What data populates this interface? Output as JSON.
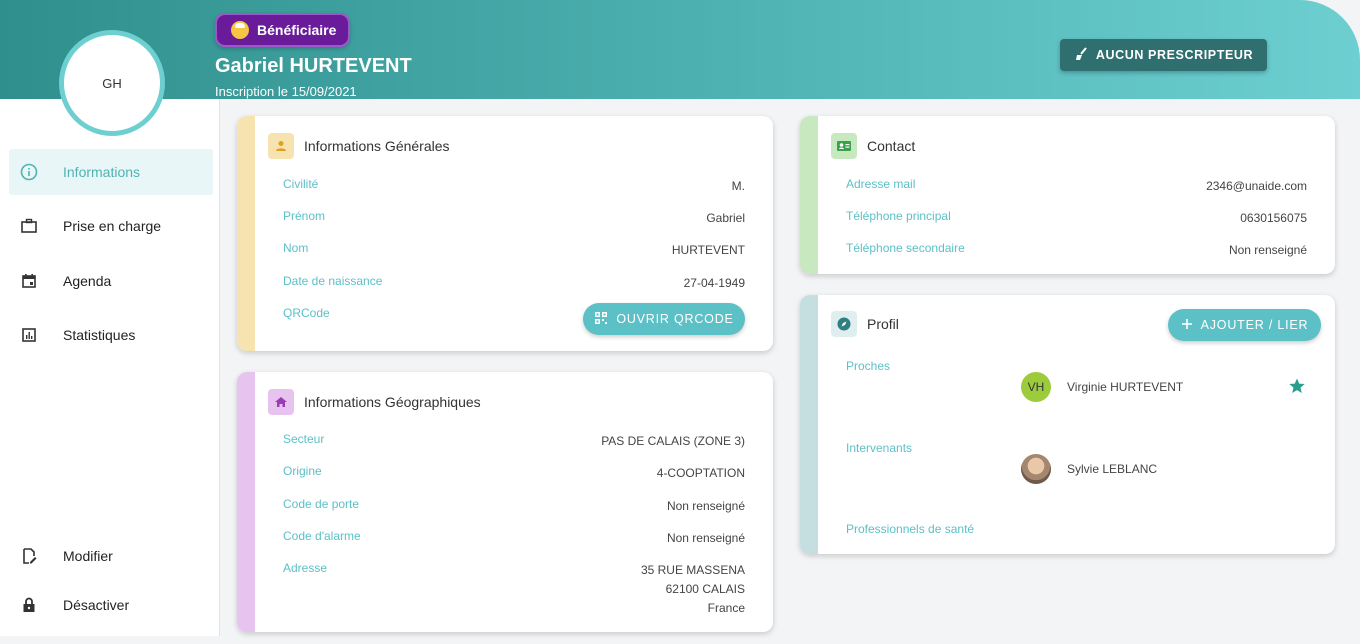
{
  "header": {
    "role_badge": "Bénéficiaire",
    "name": "Gabriel HURTEVENT",
    "inscription": "Inscription le 15/09/2021",
    "prescripteur_button": "AUCUN PRESCRIPTEUR"
  },
  "avatar": {
    "initials": "GH"
  },
  "sidebar": {
    "items": [
      {
        "label": "Informations",
        "icon": "info-icon"
      },
      {
        "label": "Prise en charge",
        "icon": "briefcase-icon"
      },
      {
        "label": "Agenda",
        "icon": "calendar-icon"
      },
      {
        "label": "Statistiques",
        "icon": "chart-icon"
      }
    ],
    "bottom_items": [
      {
        "label": "Modifier",
        "icon": "edit-icon"
      },
      {
        "label": "Désactiver",
        "icon": "lock-icon"
      }
    ]
  },
  "general": {
    "title": "Informations Générales",
    "rows": [
      {
        "key": "Civilité",
        "value": "M."
      },
      {
        "key": "Prénom",
        "value": "Gabriel"
      },
      {
        "key": "Nom",
        "value": "HURTEVENT"
      },
      {
        "key": "Date de naissance",
        "value": "27-04-1949"
      },
      {
        "key": "QRCode",
        "value": ""
      }
    ],
    "qr_button": "OUVRIR QRCODE"
  },
  "geo": {
    "title": "Informations Géographiques",
    "rows": [
      {
        "key": "Secteur",
        "value": "PAS DE CALAIS (ZONE 3)"
      },
      {
        "key": "Origine",
        "value": "4-COOPTATION"
      },
      {
        "key": "Code de porte",
        "value": "Non renseigné"
      },
      {
        "key": "Code d'alarme",
        "value": "Non renseigné"
      },
      {
        "key": "Adresse",
        "value": "35 RUE MASSENA"
      }
    ],
    "address_line2": "62100 CALAIS",
    "address_line3": "France"
  },
  "contact": {
    "title": "Contact",
    "rows": [
      {
        "key": "Adresse mail",
        "value": "2346@unaide.com"
      },
      {
        "key": "Téléphone principal",
        "value": "0630156075"
      },
      {
        "key": "Téléphone secondaire",
        "value": "Non renseigné"
      }
    ]
  },
  "profil": {
    "title": "Profil",
    "add_button": "AJOUTER / LIER",
    "proches_label": "Proches",
    "proche": {
      "initials": "VH",
      "name": "Virginie HURTEVENT"
    },
    "intervenants_label": "Intervenants",
    "intervenant": {
      "name": "Sylvie LEBLANC"
    },
    "professionnels_label": "Professionnels de santé"
  },
  "colors": {
    "accent": "#5cc0c7",
    "header_dark": "#2f8f8c",
    "badge_purple": "#6a1b9a",
    "stripe_general": "#f7e3b0",
    "stripe_geo": "#e6c4ef",
    "stripe_contact": "#c8e8c0",
    "stripe_profil": "#c5dfe0"
  }
}
